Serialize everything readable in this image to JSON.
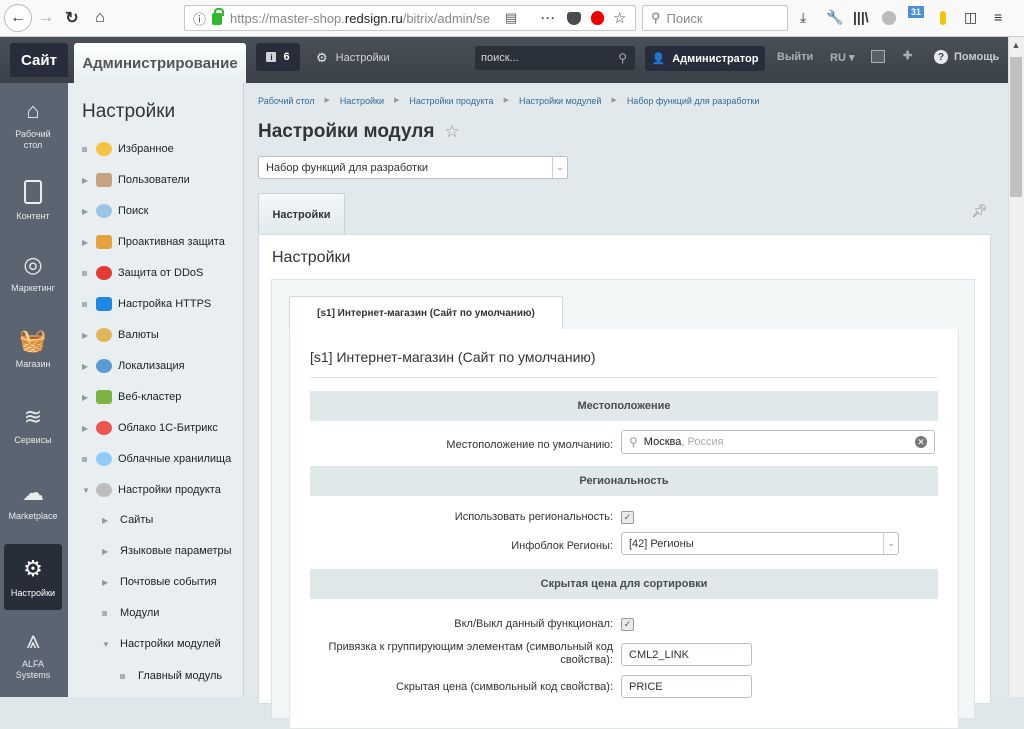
{
  "browser": {
    "url_prefix": "https://master-shop.",
    "url_domain": "redsign.ru",
    "url_suffix": "/bitrix/admin/se",
    "search_placeholder": "Поиск",
    "badge_count": "31"
  },
  "topbar": {
    "site_tab": "Сайт",
    "admin_tab": "Администрирование",
    "notifications_count": "6",
    "settings_label": "Настройки",
    "search_placeholder": "поиск...",
    "user_label": "Администратор",
    "logout_label": "Выйти",
    "lang_label": "RU",
    "help_label": "Помощь"
  },
  "leftmenu": [
    {
      "label": "Рабочий стол"
    },
    {
      "label": "Контент"
    },
    {
      "label": "Маркетинг"
    },
    {
      "label": "Магазин"
    },
    {
      "label": "Сервисы"
    },
    {
      "label": "Marketplace"
    },
    {
      "label": "Настройки"
    },
    {
      "label": "ALFA Systems"
    }
  ],
  "sidebar": {
    "title": "Настройки",
    "items": [
      {
        "label": "Избранное"
      },
      {
        "label": "Пользователи"
      },
      {
        "label": "Поиск"
      },
      {
        "label": "Проактивная защита"
      },
      {
        "label": "Защита от DDoS"
      },
      {
        "label": "Настройка HTTPS"
      },
      {
        "label": "Валюты"
      },
      {
        "label": "Локализация"
      },
      {
        "label": "Веб-кластер"
      },
      {
        "label": "Облако 1С-Битрикс"
      },
      {
        "label": "Облачные хранилища"
      },
      {
        "label": "Настройки продукта"
      },
      {
        "label": "Сайты"
      },
      {
        "label": "Языковые параметры"
      },
      {
        "label": "Почтовые события"
      },
      {
        "label": "Модули"
      },
      {
        "label": "Настройки модулей"
      },
      {
        "label": "Главный модуль"
      }
    ]
  },
  "main": {
    "breadcrumb": [
      "Рабочий стол",
      "Настройки",
      "Настройки продукта",
      "Настройки модулей",
      "Набор функций для разработки"
    ],
    "title": "Настройки модуля",
    "module_select": "Набор функций для разработки",
    "tab_label": "Настройки",
    "panel_title": "Настройки",
    "site_tab_label": "[s1] Интернет-магазин (Сайт по умолчанию)",
    "site_heading": "[s1] Интернет-магазин (Сайт по умолчанию)",
    "sections": {
      "location": "Местоположение",
      "regionality": "Региональность",
      "hidden_price": "Скрытая цена для сортировки"
    },
    "fields": {
      "default_location_label": "Местоположение по умолчанию:",
      "default_location_city": "Москва",
      "default_location_country": ", Россия",
      "use_regionality_label": "Использовать региональность:",
      "use_regionality_checked": true,
      "regions_iblock_label": "Инфоблок Регионы:",
      "regions_iblock_value": "[42] Регионы",
      "toggle_label": "Вкл/Выкл данный функционал:",
      "toggle_checked": true,
      "group_link_label": "Привязка к группирующим элементам (символьный код свойства):",
      "group_link_value": "CML2_LINK",
      "hidden_price_label": "Скрытая цена (символьный код свойства):",
      "hidden_price_value": "PRICE"
    }
  }
}
